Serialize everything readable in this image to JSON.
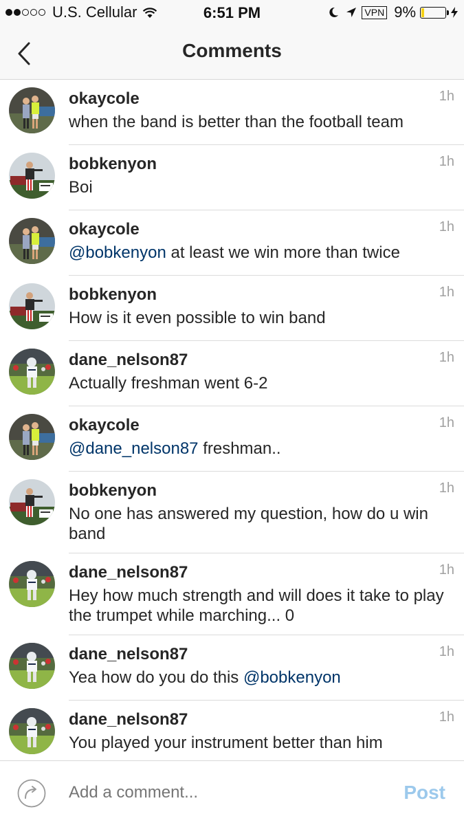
{
  "status_bar": {
    "carrier": "U.S. Cellular",
    "time": "6:51 PM",
    "vpn_label": "VPN",
    "battery_percent": "9%",
    "battery_level": 0.09,
    "signal_bars": 2
  },
  "nav": {
    "title": "Comments",
    "back_icon": "chevron-left-icon"
  },
  "colors": {
    "mention": "#003569",
    "post_disabled": "#9cc9ec",
    "timestamp": "#a0a0a0"
  },
  "comments": [
    {
      "username": "okaycole",
      "avatar": "okaycole",
      "time": "1h",
      "parts": [
        {
          "text": "when the band is better than the football team"
        }
      ]
    },
    {
      "username": "bobkenyon",
      "avatar": "bobkenyon",
      "time": "1h",
      "parts": [
        {
          "text": "Boi"
        }
      ]
    },
    {
      "username": "okaycole",
      "avatar": "okaycole",
      "time": "1h",
      "parts": [
        {
          "text": "@bobkenyon",
          "mention": true
        },
        {
          "text": " at least we win more than twice"
        }
      ]
    },
    {
      "username": "bobkenyon",
      "avatar": "bobkenyon",
      "time": "1h",
      "parts": [
        {
          "text": "How is it even possible to win band"
        }
      ]
    },
    {
      "username": "dane_nelson87",
      "avatar": "dane",
      "time": "1h",
      "parts": [
        {
          "text": "Actually freshman went 6-2"
        }
      ]
    },
    {
      "username": "okaycole",
      "avatar": "okaycole",
      "time": "1h",
      "parts": [
        {
          "text": "@dane_nelson87",
          "mention": true
        },
        {
          "text": " freshman.."
        }
      ]
    },
    {
      "username": "bobkenyon",
      "avatar": "bobkenyon",
      "time": "1h",
      "parts": [
        {
          "text": "No one has answered my question, how do u win band"
        }
      ]
    },
    {
      "username": "dane_nelson87",
      "avatar": "dane",
      "time": "1h",
      "parts": [
        {
          "text": "Hey how much strength and will does it take to play the trumpet while marching... 0"
        }
      ]
    },
    {
      "username": "dane_nelson87",
      "avatar": "dane",
      "time": "1h",
      "parts": [
        {
          "text": "Yea how do you do this "
        },
        {
          "text": "@bobkenyon",
          "mention": true
        }
      ]
    },
    {
      "username": "dane_nelson87",
      "avatar": "dane",
      "time": "1h",
      "parts": [
        {
          "text": "You played your instrument better than him"
        }
      ]
    }
  ],
  "composer": {
    "placeholder": "Add a comment...",
    "post_label": "Post",
    "icon": "reply-icon"
  }
}
